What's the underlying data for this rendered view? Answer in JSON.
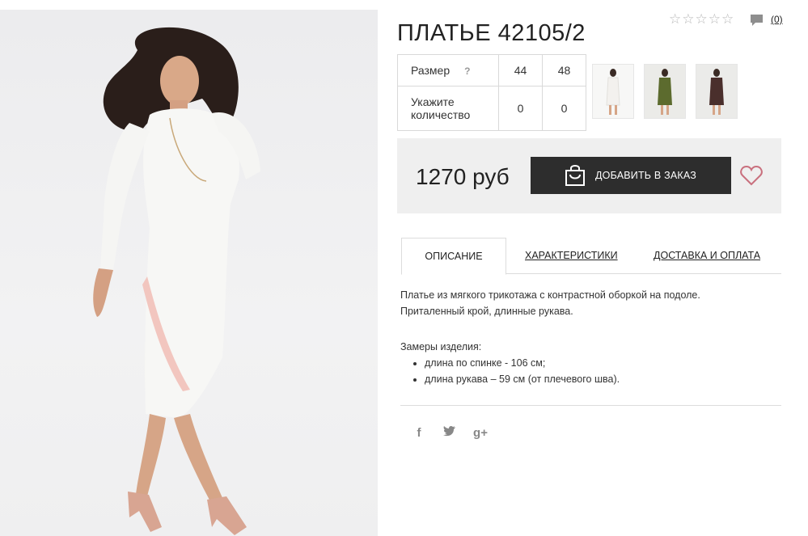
{
  "product": {
    "title": "ПЛАТЬЕ 42105/2",
    "rating_stars": 0,
    "rating_max": 5,
    "comments_count": "(0)"
  },
  "size_table": {
    "size_label": "Размер",
    "help": "?",
    "qty_label_1": "Укажите",
    "qty_label_2": "количество",
    "sizes": [
      "44",
      "48"
    ],
    "quantities": [
      "0",
      "0"
    ]
  },
  "thumbnails": [
    {
      "name": "white-dress-thumbnail",
      "color": "#f3f1ee"
    },
    {
      "name": "green-dress-thumbnail",
      "color": "#5c6b2e"
    },
    {
      "name": "brown-dress-thumbnail",
      "color": "#4a2f2c"
    }
  ],
  "price": {
    "amount": "1270 руб",
    "add_to_order": "ДОБАВИТЬ В ЗАКАЗ"
  },
  "tabs": {
    "description": "ОПИСАНИЕ",
    "characteristics": "ХАРАКТЕРИСТИКИ",
    "delivery": "ДОСТАВКА И ОПЛАТА"
  },
  "description": {
    "line1": "Платье из мягкого трикотажа с контрастной оборкой на подоле.",
    "line2": "Приталенный крой, длинные рукава.",
    "measurements_title": "Замеры изделия:",
    "measurements": [
      "длина по спинке - 106 см;",
      "длина рукава – 59 см (от плечевого шва)."
    ]
  },
  "social": {
    "facebook": "f",
    "twitter": "t",
    "google": "g+"
  },
  "colors": {
    "button": "#2d2d2d",
    "heart": "#c9707e",
    "price_bg": "#efefef"
  }
}
